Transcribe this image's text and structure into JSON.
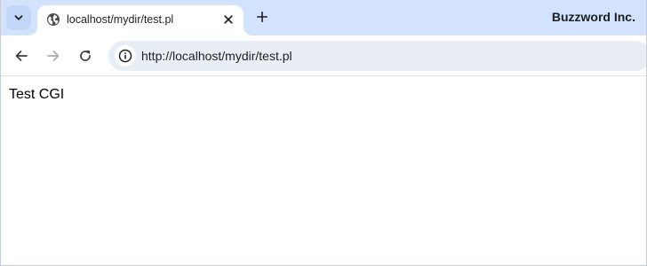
{
  "browser": {
    "tab": {
      "title": "localhost/mydir/test.pl",
      "favicon": "globe-icon"
    },
    "profile_name": "Buzzword Inc.",
    "address_bar": {
      "url": "http://localhost/mydir/test.pl",
      "site_info_icon": "info-icon"
    },
    "toolbar_icons": [
      "back-arrow-icon",
      "forward-arrow-icon",
      "reload-icon"
    ],
    "colors": {
      "tabstrip_bg": "#d3e3fd",
      "omnibox_bg": "#e9eef6",
      "text": "#1f1f1f"
    }
  },
  "page": {
    "body_text": "Test CGI"
  }
}
